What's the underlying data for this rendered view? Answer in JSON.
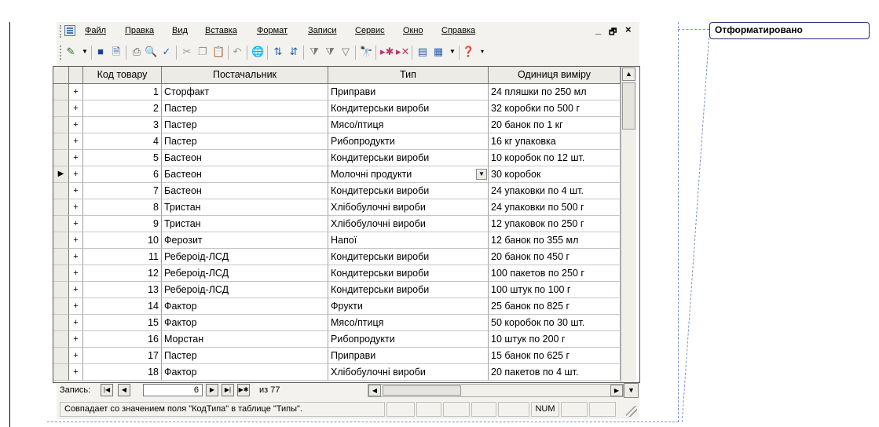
{
  "window": {
    "menu": [
      "Файл",
      "Правка",
      "Вид",
      "Вставка",
      "Формат",
      "Записи",
      "Сервис",
      "Окно",
      "Справка"
    ],
    "controls": [
      "_",
      "🗗",
      "×"
    ]
  },
  "comment": {
    "label": "Отформатировано"
  },
  "table": {
    "columns": [
      "Код товару",
      "Постачальник",
      "Тип",
      "Одиниця виміру"
    ],
    "selected_row_index": 5,
    "rows": [
      {
        "id": "1",
        "supplier": "Сторфакт",
        "type": "Приправи",
        "unit": "24 пляшки по 250 мл"
      },
      {
        "id": "2",
        "supplier": "Пастер",
        "type": "Кондитерськи вироби",
        "unit": "32 коробки по 500 г"
      },
      {
        "id": "3",
        "supplier": "Пастер",
        "type": "Мясо/птиця",
        "unit": "20 банок по 1 кг"
      },
      {
        "id": "4",
        "supplier": "Пастер",
        "type": "Рибопродукти",
        "unit": "16 кг упаковка"
      },
      {
        "id": "5",
        "supplier": "Бастеон",
        "type": "Кондитерськи вироби",
        "unit": "10 коробок по 12 шт."
      },
      {
        "id": "6",
        "supplier": "Бастеон",
        "type": "Молочні продукти",
        "unit": "30 коробок"
      },
      {
        "id": "7",
        "supplier": "Бастеон",
        "type": "Кондитерськи вироби",
        "unit": "24 упаковки по 4 шт."
      },
      {
        "id": "8",
        "supplier": "Тристан",
        "type": "Хлібобулочні вироби",
        "unit": "24 упаковки по 500 г"
      },
      {
        "id": "9",
        "supplier": "Тристан",
        "type": "Хлібобулочні вироби",
        "unit": "12 упаковок по 250 г"
      },
      {
        "id": "10",
        "supplier": "Ферозит",
        "type": "Напої",
        "unit": "12 банок по 355 мл"
      },
      {
        "id": "11",
        "supplier": "Ребероід-ЛСД",
        "type": "Кондитерськи вироби",
        "unit": "20 банок по 450 г"
      },
      {
        "id": "12",
        "supplier": "Ребероід-ЛСД",
        "type": "Кондитерськи вироби",
        "unit": "100 пакетов по 250 г"
      },
      {
        "id": "13",
        "supplier": "Ребероід-ЛСД",
        "type": "Кондитерськи вироби",
        "unit": "100 штук по 100 г"
      },
      {
        "id": "14",
        "supplier": "Фактор",
        "type": "Фрукти",
        "unit": "25 банок по 825 г"
      },
      {
        "id": "15",
        "supplier": "Фактор",
        "type": "Мясо/птиця",
        "unit": "50 коробок по 30 шт."
      },
      {
        "id": "16",
        "supplier": "Морстан",
        "type": "Рибопродукти",
        "unit": "10 штук по 200 г"
      },
      {
        "id": "17",
        "supplier": "Пастер",
        "type": "Приправи",
        "unit": "15 банок по 625 г"
      },
      {
        "id": "18",
        "supplier": "Фактор",
        "type": "Хлібобулочні вироби",
        "unit": "20 пакетов по 4 шт."
      }
    ]
  },
  "navigation": {
    "label": "Запись:",
    "current": "6",
    "of_text": "из 77"
  },
  "status": {
    "message": "Совпадает со значением поля \"КодТипа\" в таблице \"Типы\".",
    "num": "NUM"
  }
}
